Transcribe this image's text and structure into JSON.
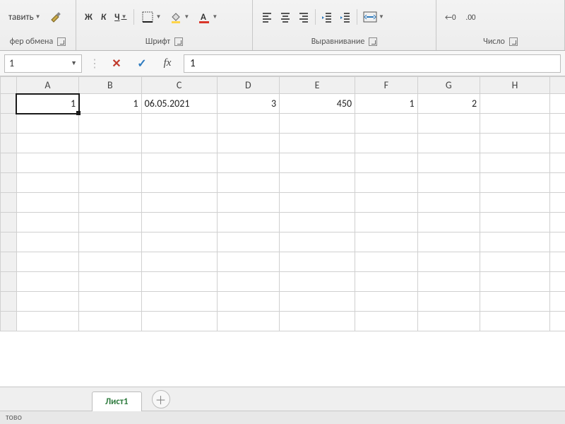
{
  "ribbon": {
    "clipboard": {
      "paste_label": "тавить",
      "group_label": "фер обмена"
    },
    "font": {
      "bold": "Ж",
      "italic": "К",
      "underline": "Ч",
      "group_label": "Шрифт"
    },
    "alignment": {
      "group_label": "Выравнивание"
    },
    "number": {
      "group_label": "Число",
      "inc_dec_a": "←0",
      "inc_dec_b": ".00"
    }
  },
  "formula_bar": {
    "name_box": "1",
    "formula_value": "1",
    "fx_label": "fx"
  },
  "columns": [
    "A",
    "B",
    "C",
    "D",
    "E",
    "F",
    "G",
    "H"
  ],
  "cells": {
    "A1": "1",
    "B1": "1",
    "C1": "06.05.2021",
    "D1": "3",
    "E1": "450",
    "F1": "1",
    "G1": "2"
  },
  "sheet": {
    "tab1": "Лист1"
  },
  "status": {
    "text": "тово"
  }
}
